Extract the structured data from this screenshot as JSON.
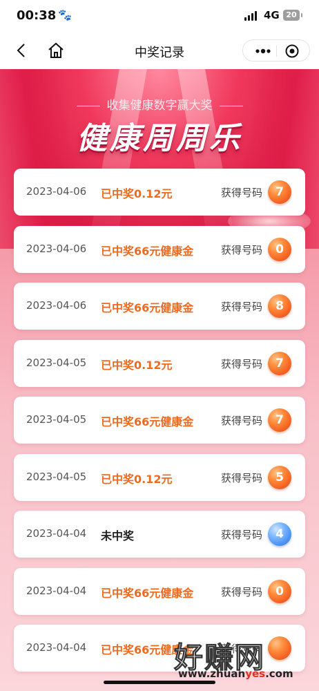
{
  "status_bar": {
    "time": "00:38",
    "network": "4G",
    "battery": "20"
  },
  "nav": {
    "title": "中奖记录"
  },
  "banner": {
    "subtitle": "收集健康数字赢大奖",
    "title": "健康周周乐"
  },
  "records": [
    {
      "date": "2023-04-06",
      "status": "已中奖0.12元",
      "won": true,
      "label": "获得号码",
      "number": "7",
      "ball_color": "orange"
    },
    {
      "date": "2023-04-06",
      "status": "已中奖66元健康金",
      "won": true,
      "label": "获得号码",
      "number": "0",
      "ball_color": "orange"
    },
    {
      "date": "2023-04-06",
      "status": "已中奖66元健康金",
      "won": true,
      "label": "获得号码",
      "number": "8",
      "ball_color": "orange"
    },
    {
      "date": "2023-04-05",
      "status": "已中奖0.12元",
      "won": true,
      "label": "获得号码",
      "number": "7",
      "ball_color": "orange"
    },
    {
      "date": "2023-04-05",
      "status": "已中奖66元健康金",
      "won": true,
      "label": "获得号码",
      "number": "7",
      "ball_color": "orange"
    },
    {
      "date": "2023-04-05",
      "status": "已中奖0.12元",
      "won": true,
      "label": "获得号码",
      "number": "5",
      "ball_color": "orange"
    },
    {
      "date": "2023-04-04",
      "status": "未中奖",
      "won": false,
      "label": "获得号码",
      "number": "4",
      "ball_color": "blue"
    },
    {
      "date": "2023-04-04",
      "status": "已中奖66元健康金",
      "won": true,
      "label": "获得号码",
      "number": "0",
      "ball_color": "orange"
    },
    {
      "date": "2023-04-04",
      "status": "已中奖66元健康金",
      "won": true,
      "label": "获得号码",
      "number": "",
      "ball_color": "orange"
    }
  ],
  "watermark": {
    "text": "好赚网",
    "url_prefix": "www.zhuan",
    "url_highlight": "yes",
    "url_suffix": ".com"
  },
  "colors": {
    "accent_orange": "#ee6a1e",
    "banner_red": "#d81c45",
    "ball_blue": "#3b86f0"
  }
}
